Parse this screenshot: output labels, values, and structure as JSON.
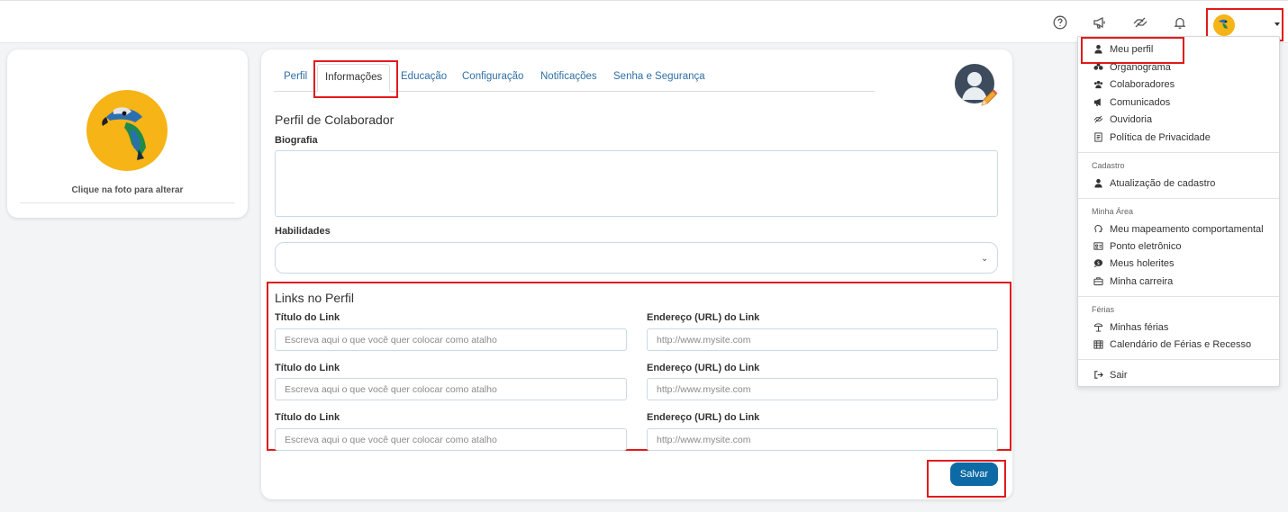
{
  "left_card": {
    "hint": "Clique na foto para alterar"
  },
  "tabs": [
    {
      "label": "Perfil",
      "active": false
    },
    {
      "label": "Informações",
      "active": true
    },
    {
      "label": "Educação",
      "active": false
    },
    {
      "label": "Configuração",
      "active": false
    },
    {
      "label": "Notificações",
      "active": false
    },
    {
      "label": "Senha e Segurança",
      "active": false
    }
  ],
  "profile_section": {
    "title": "Perfil de Colaborador",
    "biography_label": "Biografia",
    "skills_label": "Habilidades"
  },
  "links_section": {
    "title": "Links no Perfil",
    "rows": [
      {
        "title_label": "Título do Link",
        "title_placeholder": "Escreva aqui o que você quer colocar como atalho",
        "url_label": "Endereço (URL) do Link",
        "url_placeholder": "http://www.mysite.com"
      },
      {
        "title_label": "Título do Link",
        "title_placeholder": "Escreva aqui o que você quer colocar como atalho",
        "url_label": "Endereço (URL) do Link",
        "url_placeholder": "http://www.mysite.com"
      },
      {
        "title_label": "Título do Link",
        "title_placeholder": "Escreva aqui o que você quer colocar como atalho",
        "url_label": "Endereço (URL) do Link",
        "url_placeholder": "http://www.mysite.com"
      }
    ]
  },
  "save_label": "Salvar",
  "dropdown": {
    "items": [
      {
        "label": "Meu perfil",
        "icon": "person-icon"
      },
      {
        "label": "Organograma",
        "icon": "sitemap-icon"
      },
      {
        "label": "Colaboradores",
        "icon": "users-icon"
      },
      {
        "label": "Comunicados",
        "icon": "megaphone-icon"
      },
      {
        "label": "Ouvidoria",
        "icon": "handshake-icon"
      },
      {
        "label": "Política de Privacidade",
        "icon": "document-icon"
      }
    ],
    "groups": [
      {
        "label": "Cadastro",
        "items": [
          {
            "label": "Atualização de cadastro",
            "icon": "person-icon"
          }
        ]
      },
      {
        "label": "Minha Área",
        "items": [
          {
            "label": "Meu mapeamento comportamental",
            "icon": "brain-icon"
          },
          {
            "label": "Ponto eletrônico",
            "icon": "id-card-icon"
          },
          {
            "label": "Meus holerites",
            "icon": "money-bubble-icon"
          },
          {
            "label": "Minha carreira",
            "icon": "briefcase-icon"
          }
        ]
      },
      {
        "label": "Férias",
        "items": [
          {
            "label": "Minhas férias",
            "icon": "umbrella-beach-icon"
          },
          {
            "label": "Calendário de Férias e Recesso",
            "icon": "calendar-icon"
          }
        ]
      }
    ],
    "logout": {
      "label": "Sair",
      "icon": "sign-out-icon"
    }
  },
  "colors": {
    "accent": "#0d6aa5",
    "tab_link": "#2f6ea5",
    "highlight": "#e01b1b",
    "avatar_bg": "#f6b417"
  }
}
